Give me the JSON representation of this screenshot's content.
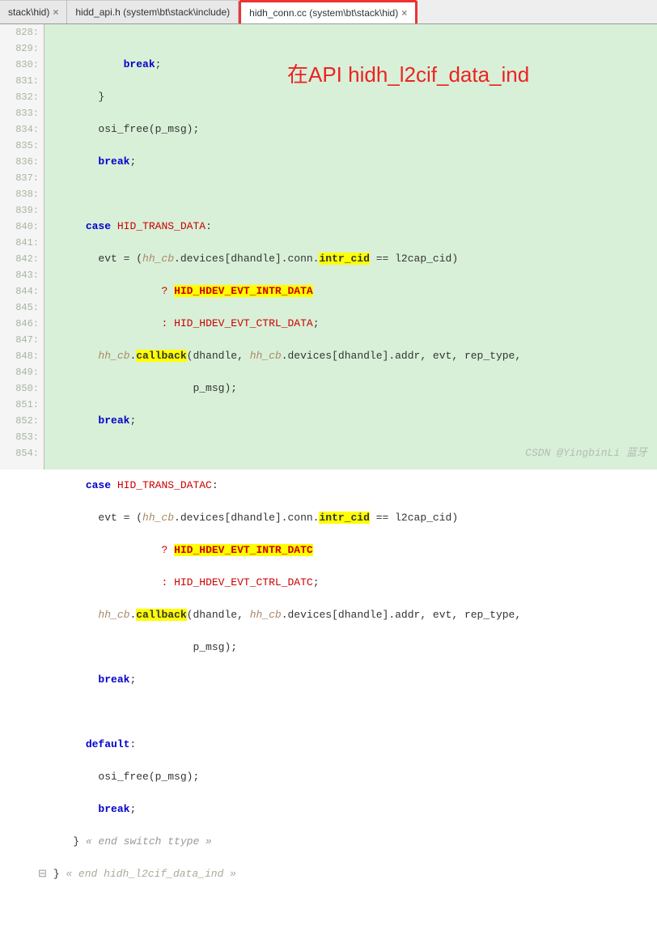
{
  "tabs": {
    "t0": "stack\\hid)",
    "t1": "hidd_api.h (system\\bt\\stack\\include)",
    "t2": "hidh_conn.cc (system\\bt\\stack\\hid)",
    "close": "×"
  },
  "annotation": "在API hidh_l2cif_data_ind",
  "watermark": "CSDN @YingbinLi 蓝牙",
  "gutter": [
    "828:",
    "829:",
    "830:",
    "831:",
    "832:",
    "833:",
    "834:",
    "835:",
    "836:",
    "837:",
    "838:",
    "839:",
    "840:",
    "841:",
    "842:",
    "843:",
    "844:",
    "845:",
    "846:",
    "847:",
    "848:",
    "849:",
    "850:",
    "851:",
    "852:",
    "853:",
    "854:"
  ],
  "code": {
    "k_break": "break",
    "k_case": "case",
    "k_default": "default",
    "semi": ";",
    "q": "?",
    "colon": ":",
    "brace_close": "}",
    "osi_free": "osi_free(p_msg);",
    "c_HID_TRANS_DATA": "HID_TRANS_DATA",
    "c_HID_TRANS_DATAC": "HID_TRANS_DATAC",
    "evt_eq": "evt = (",
    "hh_cb": "hh_cb",
    "devices": ".devices[dhandle].conn.",
    "intr_cid": "intr_cid",
    "eq_l2cap": " == l2cap_cid)",
    "intr_data": "HID_HDEV_EVT_INTR_DATA",
    "ctrl_data": "HID_HDEV_EVT_CTRL_DATA",
    "intr_datc": "HID_HDEV_EVT_INTR_DATC",
    "ctrl_datc": "HID_HDEV_EVT_CTRL_DATC",
    "callback": "callback",
    "cb_args": "(dhandle, ",
    "cb_args2": ".devices[dhandle].addr, evt, rep_type,",
    "pmsg": "p_msg);",
    "cmt_switch": " « end switch ttype »",
    "cmt_fn": " « end hidh_l2cif_data_ind »"
  }
}
